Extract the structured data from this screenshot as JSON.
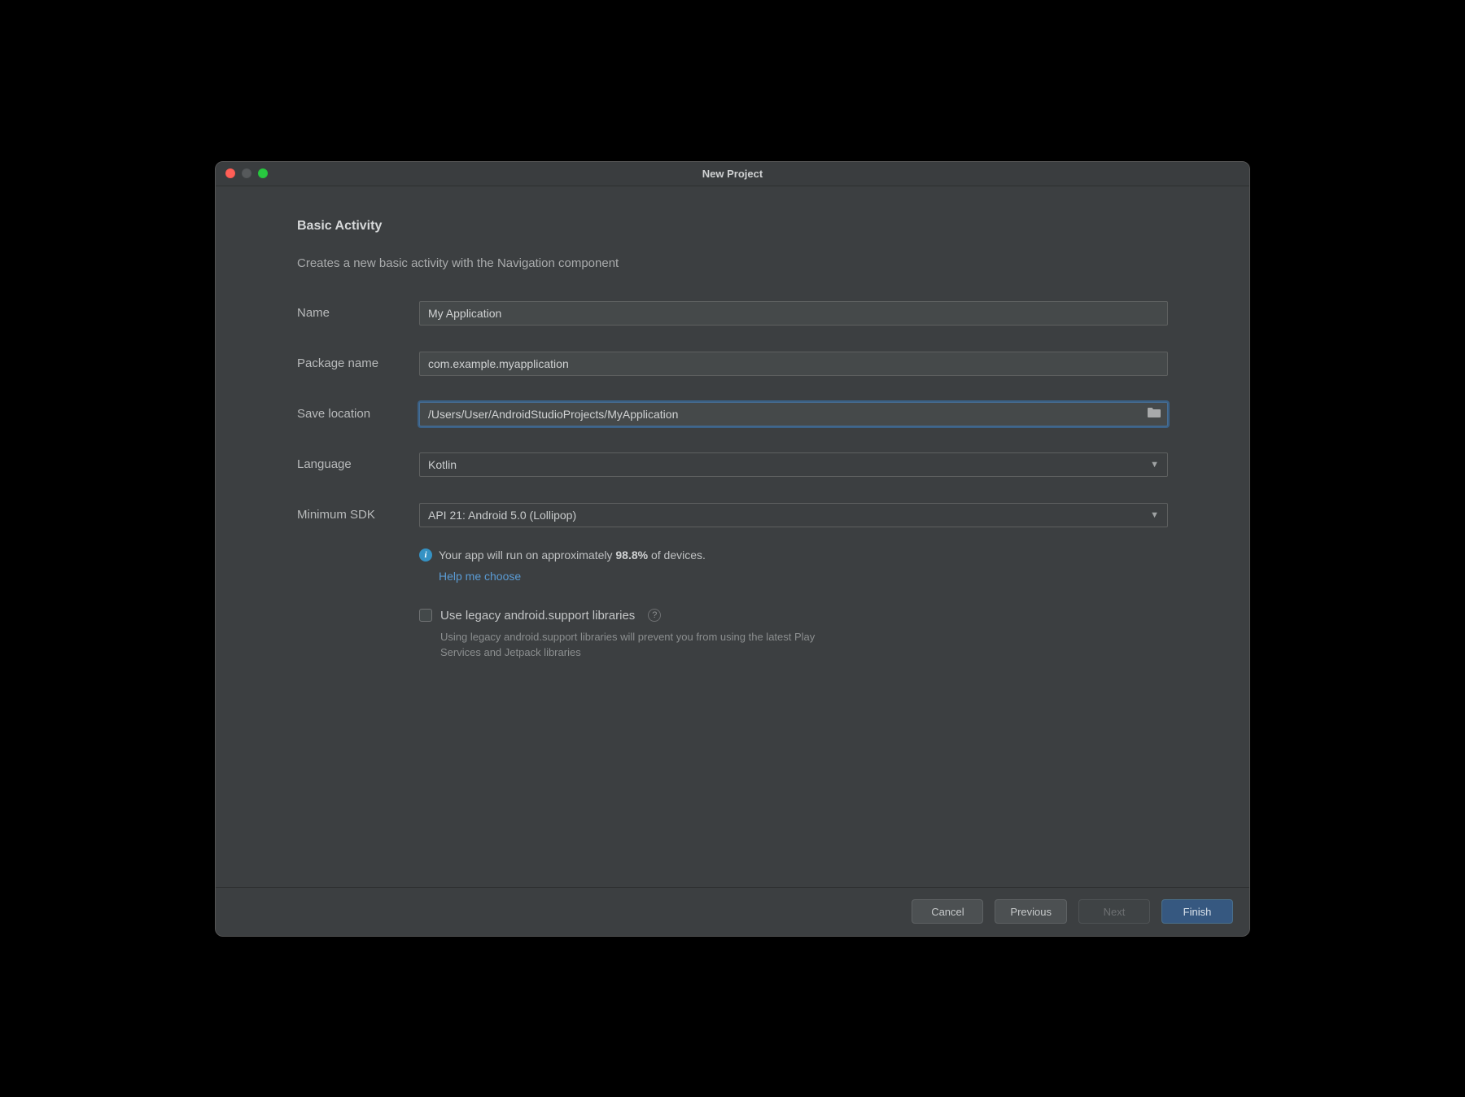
{
  "window": {
    "title": "New Project"
  },
  "section": {
    "title": "Basic Activity",
    "description": "Creates a new basic activity with the Navigation component"
  },
  "form": {
    "name": {
      "label": "Name",
      "value": "My Application"
    },
    "package": {
      "label": "Package name",
      "value": "com.example.myapplication"
    },
    "location": {
      "label": "Save location",
      "value": "/Users/User/AndroidStudioProjects/MyApplication"
    },
    "language": {
      "label": "Language",
      "value": "Kotlin"
    },
    "minsdk": {
      "label": "Minimum SDK",
      "value": "API 21: Android 5.0 (Lollipop)"
    }
  },
  "info": {
    "prefix": "Your app will run on approximately ",
    "percent": "98.8%",
    "suffix": " of devices.",
    "help_link": "Help me choose"
  },
  "legacy": {
    "label": "Use legacy android.support libraries",
    "help": "Using legacy android.support libraries will prevent you from using the latest Play Services and Jetpack libraries"
  },
  "buttons": {
    "cancel": "Cancel",
    "previous": "Previous",
    "next": "Next",
    "finish": "Finish"
  }
}
